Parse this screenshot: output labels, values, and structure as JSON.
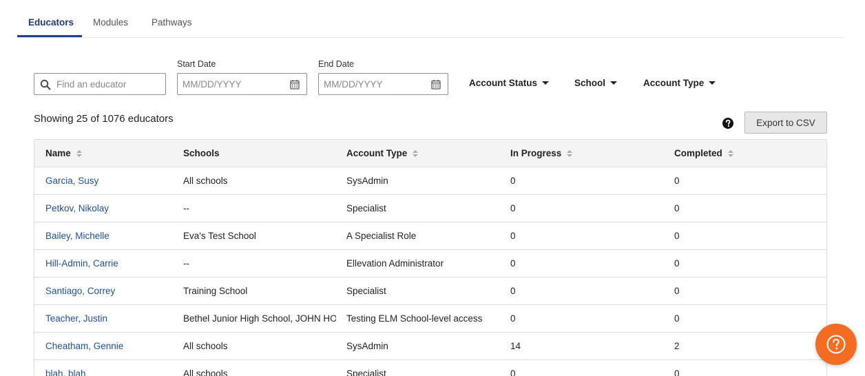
{
  "tabs": [
    {
      "label": "Educators",
      "active": true
    },
    {
      "label": "Modules",
      "active": false
    },
    {
      "label": "Pathways",
      "active": false
    }
  ],
  "filters": {
    "search_placeholder": "Find an educator",
    "start_date_label": "Start Date",
    "start_date_placeholder": "MM/DD/YYYY",
    "end_date_label": "End Date",
    "end_date_placeholder": "MM/DD/YYYY",
    "dropdowns": [
      {
        "label": "Account Status"
      },
      {
        "label": "School"
      },
      {
        "label": "Account Type"
      }
    ]
  },
  "summary": "Showing 25 of 1076 educators",
  "export_label": "Export to CSV",
  "table": {
    "headers": [
      "Name",
      "Schools",
      "Account Type",
      "In Progress",
      "Completed"
    ],
    "rows": [
      [
        "Garcia, Susy",
        "All schools",
        "SysAdmin",
        "0",
        "0"
      ],
      [
        "Petkov, Nikolay",
        "--",
        "Specialist",
        "0",
        "0"
      ],
      [
        "Bailey, Michelle",
        "Eva's Test School",
        "A Specialist Role",
        "0",
        "0"
      ],
      [
        "Hill-Admin, Carrie",
        "--",
        "Ellevation Administrator",
        "0",
        "0"
      ],
      [
        "Santiago, Correy",
        "Training School",
        "Specialist",
        "0",
        "0"
      ],
      [
        "Teacher, Justin",
        "Bethel Junior High School, JOHN HOPKINS",
        "Testing ELM School-level access",
        "0",
        "0"
      ],
      [
        "Cheatham, Gennie",
        "All schools",
        "SysAdmin",
        "14",
        "2"
      ],
      [
        "blah, blah",
        "All schools",
        "Specialist",
        "0",
        "0"
      ]
    ]
  },
  "colors": {
    "accent": "#1f3f8a",
    "link": "#1f4f99",
    "fab": "#f26d21"
  },
  "icons": {
    "search": "search-icon",
    "calendar": "calendar-icon",
    "sort": "sort-icon",
    "help": "help-icon",
    "fab": "question-circle-icon"
  }
}
